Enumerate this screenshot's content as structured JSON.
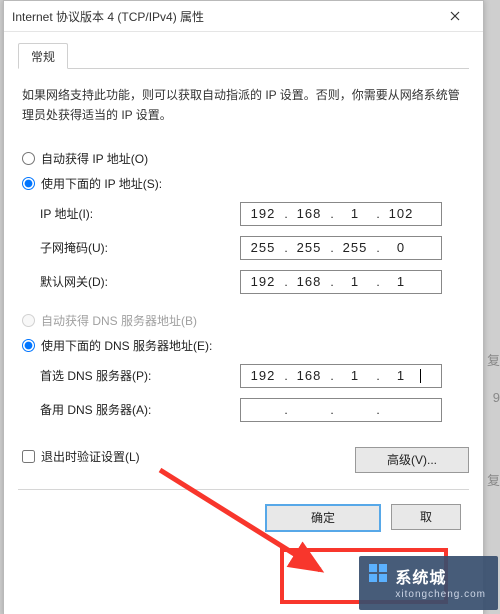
{
  "window": {
    "title": "Internet 协议版本 4 (TCP/IPv4) 属性"
  },
  "tab": {
    "general": "常规"
  },
  "desc": "如果网络支持此功能，则可以获取自动指派的 IP 设置。否则，你需要从网络系统管理员处获得适当的 IP 设置。",
  "ip": {
    "auto": "自动获得 IP 地址(O)",
    "manual": "使用下面的 IP 地址(S):",
    "addr_label": "IP 地址(I):",
    "mask_label": "子网掩码(U):",
    "gw_label": "默认网关(D):",
    "addr": [
      "192",
      "168",
      "1",
      "102"
    ],
    "mask": [
      "255",
      "255",
      "255",
      "0"
    ],
    "gw": [
      "192",
      "168",
      "1",
      "1"
    ]
  },
  "dns": {
    "auto": "自动获得 DNS 服务器地址(B)",
    "manual": "使用下面的 DNS 服务器地址(E):",
    "pref_label": "首选 DNS 服务器(P):",
    "alt_label": "备用 DNS 服务器(A):",
    "pref": [
      "192",
      "168",
      "1",
      "1"
    ],
    "alt": [
      "",
      "",
      "",
      ""
    ]
  },
  "validate": "退出时验证设置(L)",
  "buttons": {
    "advanced": "高级(V)...",
    "ok": "确定",
    "cancel": "取"
  },
  "watermark": {
    "name": "系统城",
    "url": "xitongcheng.com"
  },
  "side": {
    "a": "复",
    "b": "9",
    "c": "复"
  }
}
